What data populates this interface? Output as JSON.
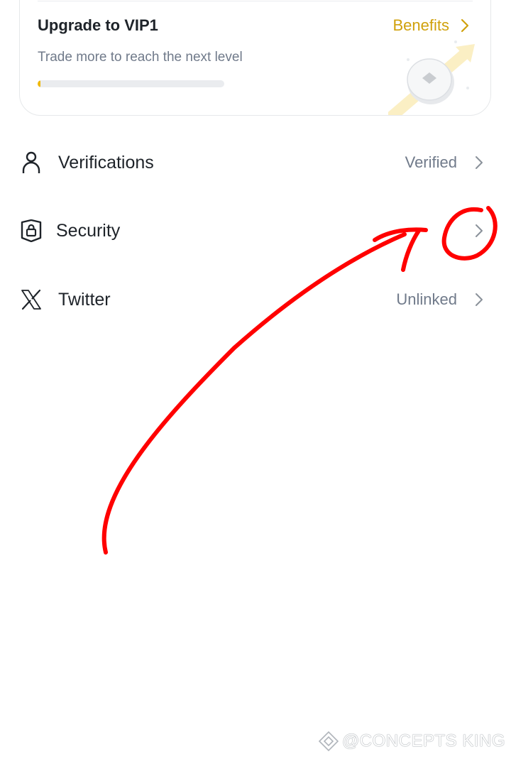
{
  "vip": {
    "title": "Upgrade to VIP1",
    "benefits_label": "Benefits",
    "subtitle": "Trade more to reach the next level",
    "progress_fraction": 0.01
  },
  "settings": [
    {
      "icon": "person-icon",
      "label": "Verifications",
      "status": "Verified"
    },
    {
      "icon": "lock-shield-icon",
      "label": "Security",
      "status": ""
    },
    {
      "icon": "x-logo-icon",
      "label": "Twitter",
      "status": "Unlinked"
    }
  ],
  "watermark": {
    "text": "@CONCEPTS KING"
  },
  "colors": {
    "accent": "#F0B90B",
    "benefits": "#D0A10C",
    "annotation": "#FF0000",
    "muted": "#707A8A"
  }
}
